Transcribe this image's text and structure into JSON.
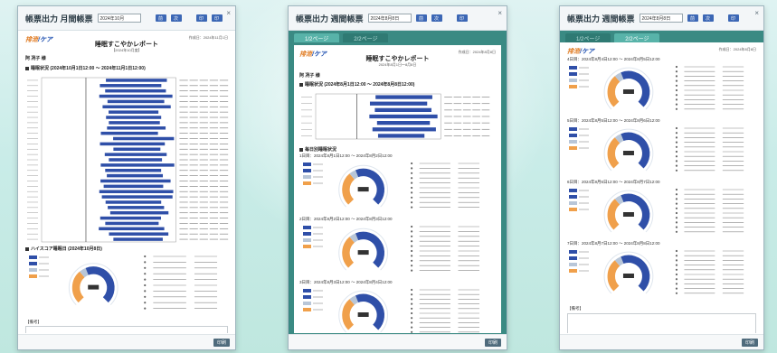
{
  "windows": [
    {
      "title": "帳票出力 月間帳票",
      "date_value": "2024年10月",
      "button_labels": [
        "前",
        "次",
        "印"
      ],
      "logo": {
        "text_a": "排泄",
        "text_b": "ケア"
      },
      "doc_title": "睡眠すこやかレポート",
      "doc_subtitle": "【2024年10月度】",
      "print_date": "作成日：2024年11月1日",
      "person": "阿 冽子 様",
      "section_sleep": "睡眠状況 (2024年10月1日12:00 ～ 2024年11月1日12:00)",
      "section_highscore": "ハイスコア睡眠日 (2024年10月8日)",
      "remarks_label": "【備考】",
      "print_button": "印刷"
    },
    {
      "title": "帳票出力 週間帳票",
      "date_value": "2024年8月8日",
      "button_labels": [
        "前",
        "次",
        "印"
      ],
      "tabs": [
        "1/2ページ",
        "2/2ページ"
      ],
      "logo": {
        "text_a": "排泄",
        "text_b": "ケア"
      },
      "doc_title": "睡眠すこやかレポート",
      "doc_subtitle": "2024年8月1日～8月8日",
      "print_date": "作成日：2024年8月8日",
      "person": "阿 冽子 様",
      "section_sleep": "睡眠状況 (2024年8月1日12:00 ～ 2024年8月8日12:00)",
      "section_daily": "毎日別睡眠状況",
      "day_labels": [
        "1日目：2024年8月1日12:00 ～ 2024年8月2日12:00",
        "2日目：2024年8月2日12:00 ～ 2024年8月3日12:00",
        "3日目：2024年8月3日12:00 ～ 2024年8月4日12:00"
      ],
      "print_button": "印刷"
    },
    {
      "title": "帳票出力 週間帳票",
      "date_value": "2024年8月8日",
      "button_labels": [
        "前",
        "次",
        "印"
      ],
      "tabs": [
        "1/2ページ",
        "2/2ページ"
      ],
      "logo": {
        "text_a": "排泄",
        "text_b": "ケア"
      },
      "print_date": "作成日：2024年8月8日",
      "day_labels": [
        "4日目：2024年8月4日12:00 ～ 2024年8月5日12:00",
        "5日目：2024年8月5日12:00 ～ 2024年8月6日12:00",
        "6日目：2024年8月6日12:00 ～ 2024年8月7日12:00",
        "7日目：2024年8月7日12:00 ～ 2024年8月8日12:00"
      ],
      "remarks_label": "【備考】",
      "print_button": "印刷"
    }
  ],
  "colors": {
    "accent": "#3c67b5",
    "teal": "#3a8a83",
    "bar": "#2f4fa8",
    "donut_orange": "#f0a04b",
    "donut_blue": "#2f4fa8",
    "donut_gray": "#b8c6d8"
  }
}
